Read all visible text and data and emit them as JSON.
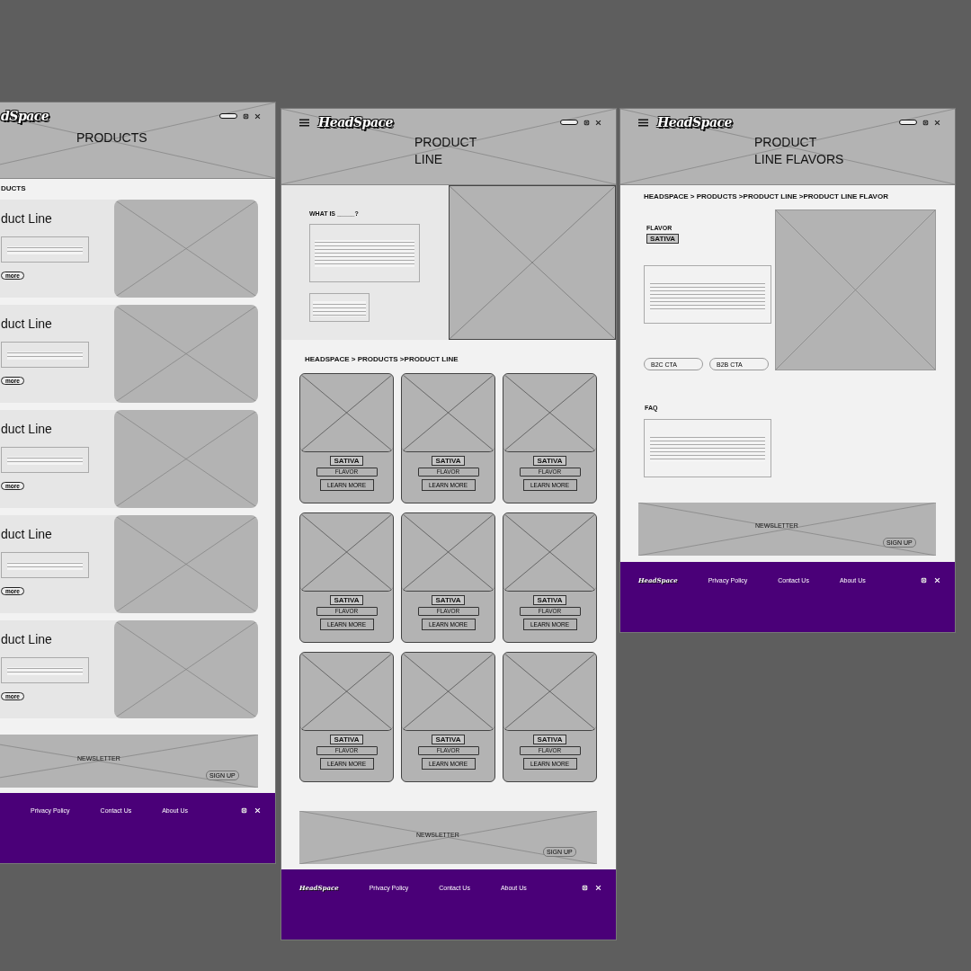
{
  "products_page": {
    "logo": "dSpace",
    "title": "PRODUCTS",
    "breadcrumb": "DUCTS",
    "product_lines": [
      {
        "title": "duct Line",
        "button": "more"
      },
      {
        "title": "duct Line",
        "button": "more"
      },
      {
        "title": "duct Line",
        "button": "more"
      },
      {
        "title": "duct Line",
        "button": "more"
      },
      {
        "title": "duct Line",
        "button": "more"
      }
    ],
    "newsletter": {
      "title": "NEWSLETTER",
      "button": "SIGN UP"
    },
    "footer": {
      "links": [
        "Privacy Policy",
        "Contact Us",
        "About Us"
      ]
    }
  },
  "product_line_page": {
    "logo": "HeadSpace",
    "title_lines": [
      "PRODUCT",
      "LINE"
    ],
    "intro_heading": "WHAT IS _____?",
    "breadcrumb": "HEADSPACE > PRODUCTS >PRODUCT LINE",
    "cards": [
      {
        "tag": "SATIVA",
        "flavor": "FLAVOR",
        "button": "LEARN MORE"
      },
      {
        "tag": "SATIVA",
        "flavor": "FLAVOR",
        "button": "LEARN MORE"
      },
      {
        "tag": "SATIVA",
        "flavor": "FLAVOR",
        "button": "LEARN MORE"
      },
      {
        "tag": "SATIVA",
        "flavor": "FLAVOR",
        "button": "LEARN MORE"
      },
      {
        "tag": "SATIVA",
        "flavor": "FLAVOR",
        "button": "LEARN MORE"
      },
      {
        "tag": "SATIVA",
        "flavor": "FLAVOR",
        "button": "LEARN MORE"
      },
      {
        "tag": "SATIVA",
        "flavor": "FLAVOR",
        "button": "LEARN MORE"
      },
      {
        "tag": "SATIVA",
        "flavor": "FLAVOR",
        "button": "LEARN MORE"
      },
      {
        "tag": "SATIVA",
        "flavor": "FLAVOR",
        "button": "LEARN MORE"
      }
    ],
    "newsletter": {
      "title": "NEWSLETTER",
      "button": "SIGN UP"
    },
    "footer": {
      "logo": "HeadSpace",
      "links": [
        "Privacy Policy",
        "Contact Us",
        "About Us"
      ]
    }
  },
  "flavor_page": {
    "logo": "HeadSpace",
    "title_lines": [
      "PRODUCT",
      "LINE FLAVORS"
    ],
    "breadcrumb": "HEADSPACE > PRODUCTS >PRODUCT LINE >PRODUCT LINE FLAVOR",
    "heading": "FLAVOR",
    "tag": "SATIVA",
    "ctas": [
      "B2C CTA",
      "B2B CTA"
    ],
    "faq_heading": "FAQ",
    "newsletter": {
      "title": "NEWSLETTER",
      "button": "SIGN UP"
    },
    "footer": {
      "logo": "HeadSpace",
      "links": [
        "Privacy Policy",
        "Contact Us",
        "About Us"
      ]
    }
  }
}
